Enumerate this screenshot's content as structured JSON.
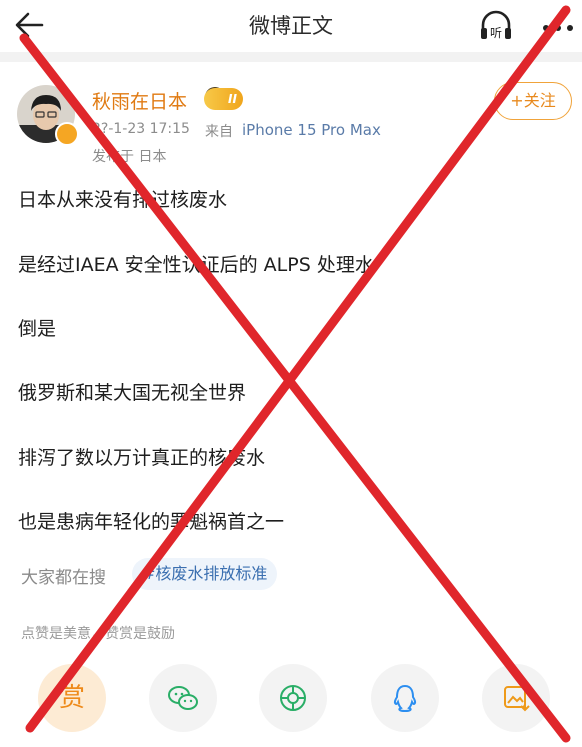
{
  "header": {
    "title": "微博正文",
    "back_icon": "arrow-left-icon",
    "listen_label": "听",
    "more_icon": "more-dots-icon"
  },
  "author": {
    "name": "秋雨在日本",
    "vip_level": "II",
    "follow_label": "+关注",
    "time": "2?-1-23 17:15",
    "source_prefix": "来自",
    "device": "iPhone 15 Pro Max",
    "location": "发布于 日本"
  },
  "post": {
    "lines": [
      "日本从来没有排过核废水",
      "是经过IAEA 安全性认证后的 ALPS 处理水",
      "倒是",
      "俄罗斯和某大国无视全世界",
      "排泻了数以万计真正的核废水",
      "也是患病年轻化的罪魁祸首之一"
    ]
  },
  "search": {
    "label": "大家都在搜",
    "tag": "#核废水排放标准"
  },
  "reward": {
    "text": "点赞是美意，赞赏是鼓励",
    "button_glyph": "赏"
  },
  "actions": [
    {
      "name": "reward",
      "icon": "reward-icon"
    },
    {
      "name": "wechat",
      "icon": "wechat-icon"
    },
    {
      "name": "moments",
      "icon": "moments-icon"
    },
    {
      "name": "qq",
      "icon": "qq-icon"
    },
    {
      "name": "save-image",
      "icon": "save-image-icon"
    }
  ],
  "colors": {
    "accent_orange": "#E8891D",
    "link_blue": "#3B6FB0",
    "overlay_red": "#E0262B"
  },
  "overlay": "red-x-mark"
}
